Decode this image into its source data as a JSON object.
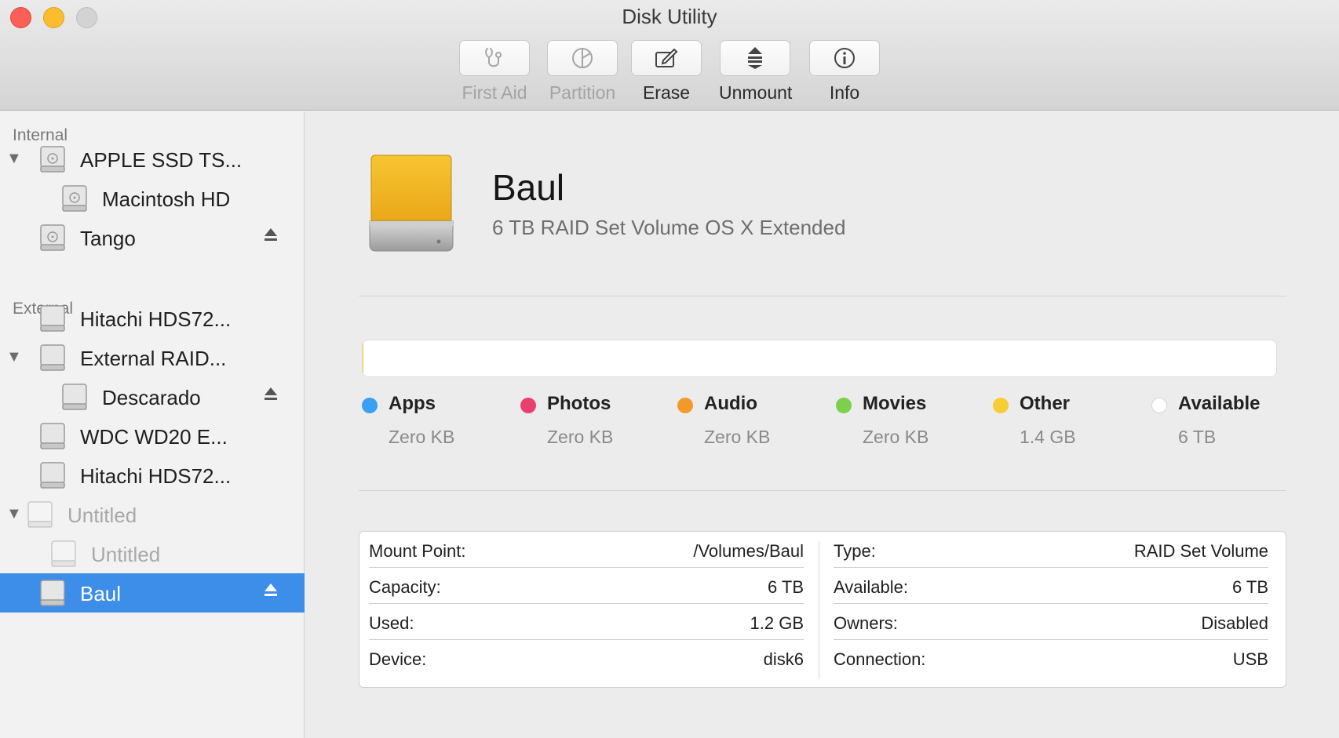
{
  "window": {
    "title": "Disk Utility"
  },
  "toolbar": {
    "buttons": [
      {
        "label": "First Aid",
        "icon": "stethoscope-icon",
        "enabled": false
      },
      {
        "label": "Partition",
        "icon": "pie-icon",
        "enabled": false
      },
      {
        "label": "Erase",
        "icon": "erase-icon",
        "enabled": true
      },
      {
        "label": "Unmount",
        "icon": "unmount-icon",
        "enabled": true
      },
      {
        "label": "Info",
        "icon": "info-icon",
        "enabled": true
      }
    ]
  },
  "sidebar": {
    "sections": {
      "internal": "Internal",
      "external": "External"
    },
    "items": [
      {
        "name": "APPLE SSD TS...",
        "level": 0,
        "disclosure": true,
        "ejectable": false,
        "dimmed": false,
        "selected": false,
        "icon": "internal-disk-icon"
      },
      {
        "name": "Macintosh HD",
        "level": 1,
        "disclosure": false,
        "ejectable": false,
        "dimmed": false,
        "selected": false,
        "icon": "internal-disk-icon"
      },
      {
        "name": "Tango",
        "level": 0,
        "disclosure": false,
        "ejectable": true,
        "dimmed": false,
        "selected": false,
        "icon": "internal-disk-icon"
      },
      {
        "name": "Hitachi HDS72...",
        "level": 0,
        "disclosure": false,
        "ejectable": false,
        "dimmed": false,
        "selected": false,
        "icon": "external-disk-icon"
      },
      {
        "name": "External RAID...",
        "level": 0,
        "disclosure": true,
        "ejectable": false,
        "dimmed": false,
        "selected": false,
        "icon": "external-disk-icon"
      },
      {
        "name": "Descarado",
        "level": 1,
        "disclosure": false,
        "ejectable": true,
        "dimmed": false,
        "selected": false,
        "icon": "external-disk-icon"
      },
      {
        "name": "WDC WD20 E...",
        "level": 0,
        "disclosure": false,
        "ejectable": false,
        "dimmed": false,
        "selected": false,
        "icon": "external-disk-icon"
      },
      {
        "name": "Hitachi HDS72...",
        "level": 0,
        "disclosure": false,
        "ejectable": false,
        "dimmed": false,
        "selected": false,
        "icon": "external-disk-icon"
      },
      {
        "name": "Untitled",
        "level": 0,
        "disclosure": true,
        "ejectable": false,
        "dimmed": true,
        "selected": false,
        "icon": "external-disk-icon"
      },
      {
        "name": "Untitled",
        "level": 1,
        "disclosure": false,
        "ejectable": false,
        "dimmed": true,
        "selected": false,
        "icon": "external-disk-icon"
      },
      {
        "name": "Baul",
        "level": 0,
        "disclosure": false,
        "ejectable": true,
        "dimmed": false,
        "selected": true,
        "icon": "external-disk-icon"
      }
    ]
  },
  "volume": {
    "name": "Baul",
    "description": "6 TB RAID Set Volume OS X Extended",
    "icon_color": "#f2b829"
  },
  "usage": {
    "legend": [
      {
        "name": "Apps",
        "value": "Zero KB",
        "color": "#3aa0f3"
      },
      {
        "name": "Photos",
        "value": "Zero KB",
        "color": "#eb3f72"
      },
      {
        "name": "Audio",
        "value": "Zero KB",
        "color": "#f19a2c"
      },
      {
        "name": "Movies",
        "value": "Zero KB",
        "color": "#7ed04c"
      },
      {
        "name": "Other",
        "value": "1.4 GB",
        "color": "#f6cd33"
      },
      {
        "name": "Available",
        "value": "6 TB",
        "color": "#ffffff"
      }
    ],
    "other_fraction": 0.0002
  },
  "info": {
    "left": [
      {
        "key": "Mount Point:",
        "value": "/Volumes/Baul"
      },
      {
        "key": "Capacity:",
        "value": "6 TB"
      },
      {
        "key": "Used:",
        "value": "1.2 GB"
      },
      {
        "key": "Device:",
        "value": "disk6"
      }
    ],
    "right": [
      {
        "key": "Type:",
        "value": "RAID Set Volume"
      },
      {
        "key": "Available:",
        "value": "6 TB"
      },
      {
        "key": "Owners:",
        "value": "Disabled"
      },
      {
        "key": "Connection:",
        "value": "USB"
      }
    ]
  }
}
